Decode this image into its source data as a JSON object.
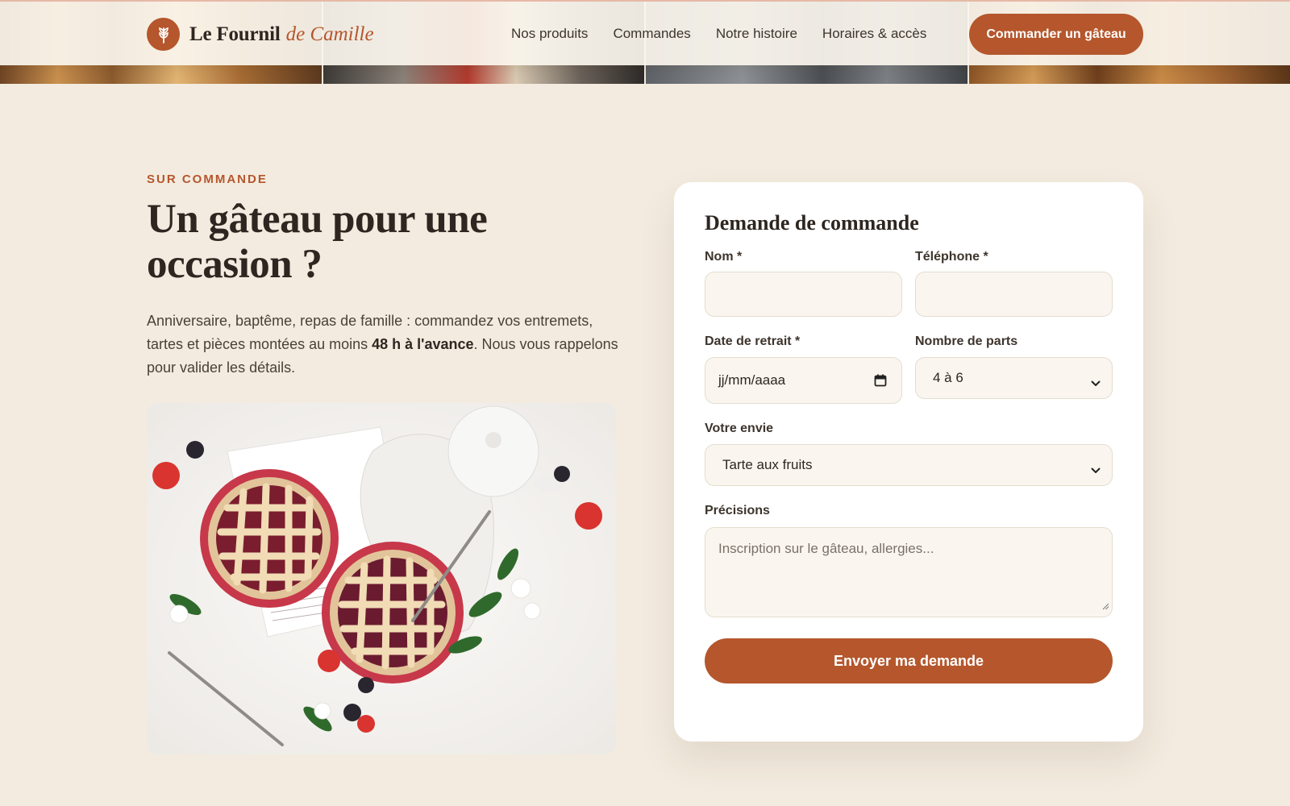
{
  "brand": {
    "name": "Le Fournil",
    "accent": "de Camille",
    "logo_icon": "wheat-icon"
  },
  "nav": {
    "links": [
      "Nos produits",
      "Commandes",
      "Notre histoire",
      "Horaires & accès"
    ],
    "cta": "Commander un gâteau"
  },
  "intro": {
    "eyebrow": "SUR COMMANDE",
    "title_line1": "Un gâteau pour une",
    "title_line2": "occasion ?",
    "lead_before": "Anniversaire, baptême, repas de famille : commandez vos entremets, tartes et pièces montées au moins ",
    "lead_bold": "48 h à l'avance",
    "lead_after": ". Nous vous rappelons pour valider les détails."
  },
  "form": {
    "title": "Demande de commande",
    "name_label": "Nom *",
    "name_value": "",
    "phone_label": "Téléphone *",
    "phone_value": "",
    "date_label": "Date de retrait *",
    "date_placeholder": "jj/mm/aaaa",
    "parts_label": "Nombre de parts",
    "parts_selected": "4 à 6",
    "wish_label": "Votre envie",
    "wish_selected": "Tarte aux fruits",
    "details_label": "Précisions",
    "details_placeholder": "Inscription sur le gâteau, allergies...",
    "submit": "Envoyer ma demande"
  },
  "colors": {
    "accent": "#b5562c",
    "background": "#f3ebdf",
    "card": "#ffffff",
    "text": "#2e2620",
    "field_bg": "#faf6ef"
  }
}
